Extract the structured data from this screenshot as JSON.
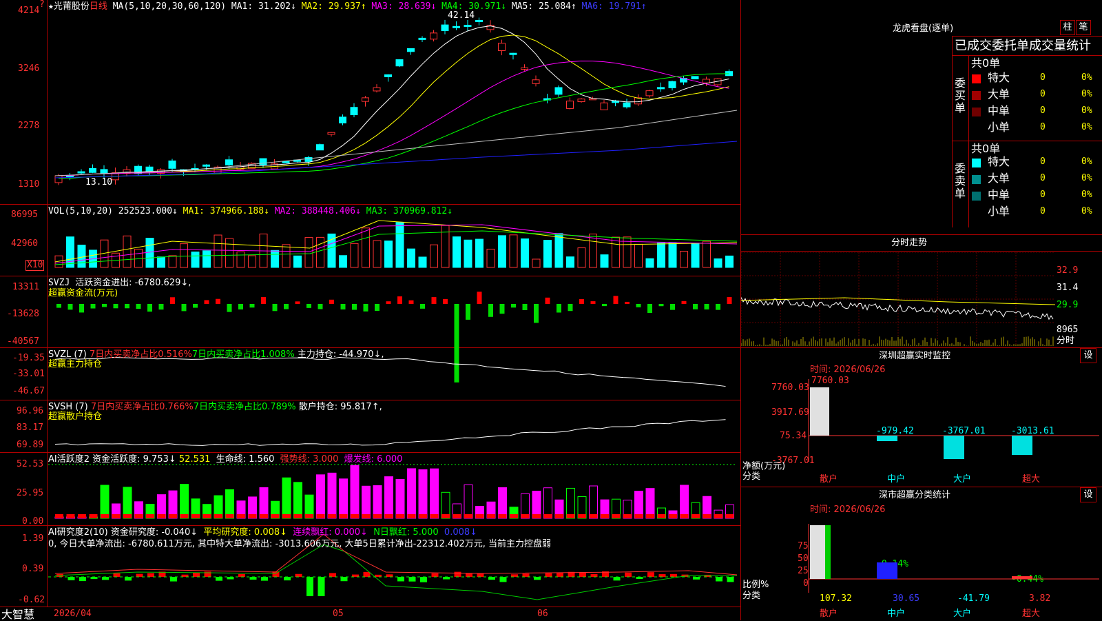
{
  "main": {
    "star": "★",
    "stock_name": "光莆股份",
    "period": "日线",
    "ma_label": "MA(5,10,20,30,60,120)",
    "ma1": "MA1: 31.202↓",
    "ma2": "MA2: 29.937↑",
    "ma3": "MA3: 28.639↓",
    "ma4": "MA4: 30.971↓",
    "ma5": "MA5: 25.084↑",
    "ma6": "MA6: 19.791↑",
    "y_labels": [
      "4214",
      "3246",
      "2278",
      "1310"
    ],
    "high_mark": "42.14",
    "low_mark": "13.10"
  },
  "vol": {
    "label": "VOL(5,10,20)",
    "value": "252523.000↓",
    "ma1": "MA1: 374966.188↓",
    "ma2": "MA2: 388448.406↓",
    "ma3": "MA3: 370969.812↓",
    "y_labels": [
      "86995",
      "42960"
    ],
    "unit": "X10"
  },
  "svzj": {
    "label": "SVZJ",
    "title": "活跃资金进出: -6780.629↓,",
    "sub": "超赢资金流(万元)",
    "y_labels": [
      "13311",
      "-13628",
      "-40567"
    ]
  },
  "svzl": {
    "label": "SVZL (7)",
    "a": "7日内买卖净占比0.516%",
    "b": "7日内买卖净占比1.008%",
    "c": "主力持仓: -44.970↓,",
    "sub": "超赢主力持仓",
    "y_labels": [
      "-19.35",
      "-33.01",
      "-46.67"
    ]
  },
  "svsh": {
    "label": "SVSH (7)",
    "a": "7日内买卖净占比0.766%",
    "b": "7日内买卖净占比0.789%",
    "c": "散户持仓: 95.817↑,",
    "sub": "超赢散户持仓",
    "y_labels": [
      "96.96",
      "83.17",
      "69.89"
    ]
  },
  "ai1": {
    "label": "AI活跃度2",
    "a": "资金活跃度: 9.753↓",
    "b": "52.531",
    "c": "生命线: 1.560",
    "d": "强势线: 3.000",
    "e": "爆发线: 6.000",
    "y_labels": [
      "52.53",
      "25.95",
      "0.00"
    ]
  },
  "ai2": {
    "label": "AI研究度2(10)",
    "a": "资金研究度: -0.040↓",
    "b": "平均研究度: 0.008↓",
    "c": "连续飘红: 0.000↓",
    "d": "N日飘红: 5.000",
    "e": "0.008↓",
    "desc": "0, 今日大单净流出: -6780.611万元, 其中特大单净流出: -3013.606万元, 大单5日累计净出-22312.402万元, 当前主力控盘弱",
    "y_labels": [
      "1.39",
      "0.39",
      "-0.62"
    ]
  },
  "bottom": {
    "brand": "大智慧",
    "date": "2026/04",
    "m05": "05",
    "m06": "06"
  },
  "right": {
    "longhu_title": "龙虎看盘(逐单)",
    "btn_zhu": "柱",
    "btn_bi": "笔",
    "stat_title": "已成交委托单成交量统计",
    "buy_label": "委买单",
    "sell_label": "委卖单",
    "buy_total": "共0单",
    "sell_total": "共0单",
    "rows": [
      {
        "name": "特大",
        "n": "0",
        "p": "0%"
      },
      {
        "name": "大单",
        "n": "0",
        "p": "0%"
      },
      {
        "name": "中单",
        "n": "0",
        "p": "0%"
      },
      {
        "name": "小单",
        "n": "0",
        "p": "0%"
      }
    ],
    "buy_colors": [
      "#ff0000",
      "#a00000",
      "#700000",
      "#000000"
    ],
    "sell_colors": [
      "#00ffff",
      "#009090",
      "#007070",
      "#000000"
    ],
    "fenshi_title": "分时走势",
    "fenshi_y": [
      "32.9",
      "31.4",
      "29.9",
      "8965"
    ],
    "fenshi_unit": "分时",
    "monitor_title": "深圳超赢实时监控",
    "set1": "设",
    "monitor_time": "时间: 2026/06/26",
    "monitor_y": [
      "7760.03",
      "3917.69",
      "75.34",
      "-3767.01"
    ],
    "monitor_top": "7760.03",
    "monitor_vals": [
      "-979.42",
      "-3767.01",
      "-3013.61"
    ],
    "monitor_ylabel": "净额(万元)",
    "monitor_xlabel": "分类",
    "cats": [
      "散户",
      "中户",
      "大户",
      "超大"
    ],
    "class_title": "深市超赢分类统计",
    "set2": "设",
    "class_time": "时间: 2026/06/26",
    "class_y": [
      "75",
      "50",
      "25",
      "0"
    ],
    "class_ylabel": "比例%",
    "class_xlabel": "分类",
    "class_pct_top": [
      "-0.14%",
      "-0.44%"
    ],
    "class_vals": [
      "107.32",
      "30.65",
      "-41.79",
      "3.82"
    ]
  }
}
